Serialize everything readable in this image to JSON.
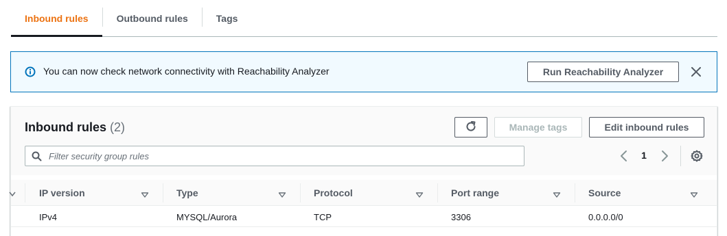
{
  "tabs": [
    {
      "label": "Inbound rules",
      "active": true
    },
    {
      "label": "Outbound rules",
      "active": false
    },
    {
      "label": "Tags",
      "active": false
    }
  ],
  "banner": {
    "icon": "info-icon",
    "message": "You can now check network connectivity with Reachability Analyzer",
    "button_label": "Run Reachability Analyzer",
    "close_icon": "close-icon"
  },
  "panel": {
    "title": "Inbound rules",
    "count": "(2)",
    "refresh_icon": "refresh-icon",
    "manage_tags_label": "Manage tags",
    "edit_label": "Edit inbound rules"
  },
  "search": {
    "placeholder": "Filter security group rules",
    "value": ""
  },
  "pagination": {
    "current_page": "1"
  },
  "table": {
    "columns": [
      "IP version",
      "Type",
      "Protocol",
      "Port range",
      "Source"
    ],
    "rows": [
      [
        "IPv4",
        "MYSQL/Aurora",
        "TCP",
        "3306",
        "0.0.0.0/0"
      ]
    ]
  },
  "colors": {
    "active_tab": "#ec7211",
    "info_blue": "#0073bb",
    "banner_bg": "#f1faff"
  }
}
